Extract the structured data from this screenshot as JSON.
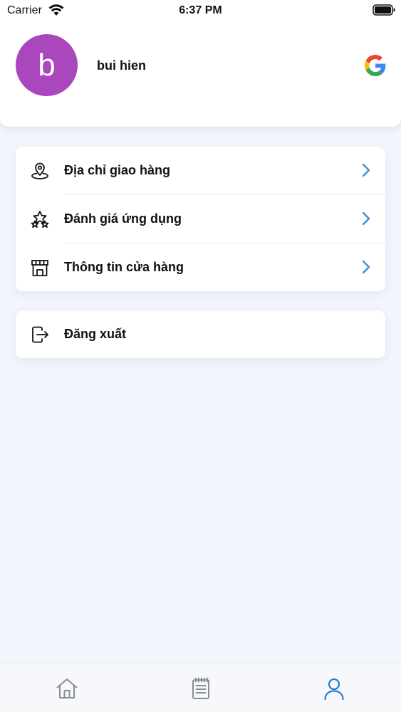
{
  "status_bar": {
    "carrier": "Carrier",
    "time": "6:37 PM"
  },
  "profile": {
    "avatar_letter": "b",
    "avatar_color": "#ab47bc",
    "name": "bui hien",
    "login_provider_icon": "google-icon"
  },
  "menu": {
    "items": [
      {
        "label": "Địa chỉ giao hàng",
        "icon": "location-pin-icon"
      },
      {
        "label": "Đánh giá ứng dụng",
        "icon": "star-rating-icon"
      },
      {
        "label": "Thông tin cửa hàng",
        "icon": "store-icon"
      }
    ],
    "chevron_color": "#3d8fd6"
  },
  "logout": {
    "label": "Đăng xuất",
    "icon": "logout-icon"
  },
  "tabbar": {
    "tabs": [
      {
        "icon": "home-icon",
        "active": false
      },
      {
        "icon": "orders-notepad-icon",
        "active": false
      },
      {
        "icon": "profile-icon",
        "active": true
      }
    ],
    "active_color": "#1f7ed0",
    "inactive_color": "#8a8d94"
  }
}
